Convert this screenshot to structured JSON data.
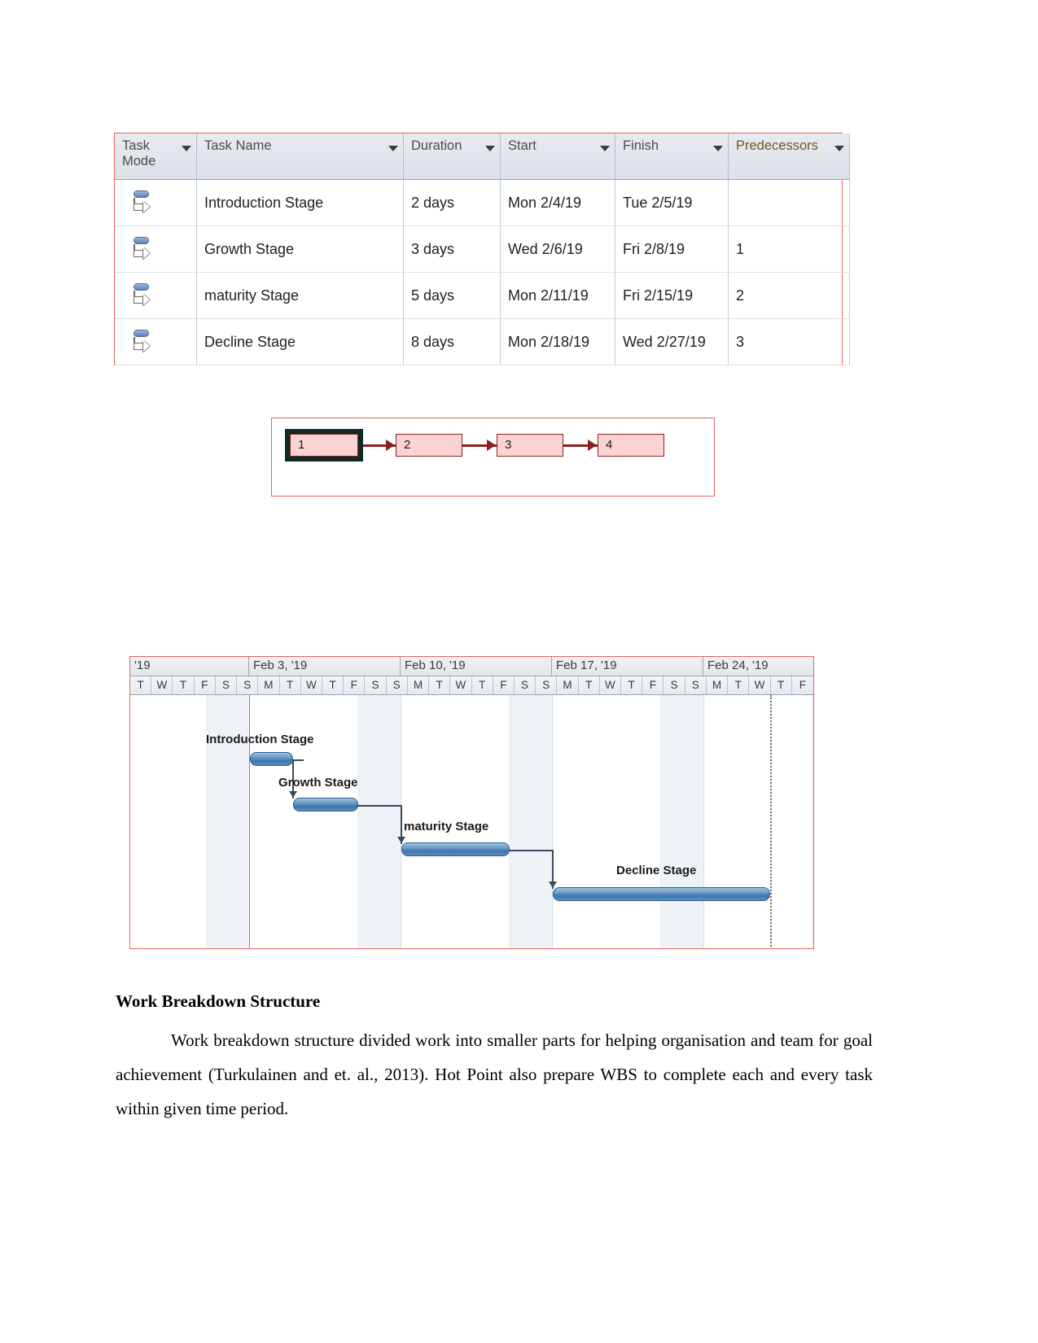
{
  "project_table": {
    "columns": [
      {
        "label": "Task Mode",
        "has_filter": true,
        "highlighted": false
      },
      {
        "label": "Task Name",
        "has_filter": true,
        "highlighted": false
      },
      {
        "label": "Duration",
        "has_filter": true,
        "highlighted": false
      },
      {
        "label": "Start",
        "has_filter": true,
        "highlighted": false
      },
      {
        "label": "Finish",
        "has_filter": true,
        "highlighted": false
      },
      {
        "label": "Predecessors",
        "has_filter": true,
        "highlighted": true
      }
    ],
    "task_mode_icon": "manual-schedule-icon",
    "rows": [
      {
        "task_name": "Introduction Stage",
        "duration": "2 days",
        "start": "Mon 2/4/19",
        "finish": "Tue 2/5/19",
        "predecessors": ""
      },
      {
        "task_name": "Growth Stage",
        "duration": "3 days",
        "start": "Wed 2/6/19",
        "finish": "Fri 2/8/19",
        "predecessors": "1"
      },
      {
        "task_name": "maturity Stage",
        "duration": "5 days",
        "start": "Mon 2/11/19",
        "finish": "Fri 2/15/19",
        "predecessors": "2"
      },
      {
        "task_name": "Decline Stage",
        "duration": "8 days",
        "start": "Mon 2/18/19",
        "finish": "Wed 2/27/19",
        "predecessors": "3"
      }
    ]
  },
  "network_diagram": {
    "nodes": [
      {
        "label": "1",
        "selected": true
      },
      {
        "label": "2",
        "selected": false
      },
      {
        "label": "3",
        "selected": false
      },
      {
        "label": "4",
        "selected": false
      }
    ],
    "link_color": "#8c2020",
    "node_fill": "#fbd3d3"
  },
  "gantt": {
    "week_headers": [
      "'19",
      "Feb 3, '19",
      "Feb 10, '19",
      "Feb 17, '19",
      "Feb 24, '19"
    ],
    "day_headers": [
      "T",
      "W",
      "T",
      "F",
      "S",
      "S",
      "M",
      "T",
      "W",
      "T",
      "F",
      "S",
      "S",
      "M",
      "T",
      "W",
      "T",
      "F",
      "S",
      "S",
      "M",
      "T",
      "W",
      "T",
      "F",
      "S",
      "S",
      "M",
      "T",
      "W",
      "T",
      "F"
    ],
    "bars": [
      {
        "label": "Introduction Stage",
        "duration_days": 2,
        "start": "Mon 2/4/19",
        "finish": "Tue 2/5/19"
      },
      {
        "label": "Growth Stage",
        "duration_days": 3,
        "start": "Wed 2/6/19",
        "finish": "Fri 2/8/19"
      },
      {
        "label": "maturity Stage",
        "duration_days": 5,
        "start": "Mon 2/11/19",
        "finish": "Fri 2/15/19"
      },
      {
        "label": "Decline Stage",
        "duration_days": 8,
        "start": "Mon 2/18/19",
        "finish": "Wed 2/27/19"
      }
    ],
    "bar_color": "#3f76ab"
  },
  "document": {
    "heading": "Work Breakdown Structure",
    "paragraph": "Work breakdown structure divided work into smaller parts for helping organisation and team for goal achievement (Turkulainen and et. al., 2013). Hot Point also prepare WBS to complete each and every task within given time period."
  }
}
